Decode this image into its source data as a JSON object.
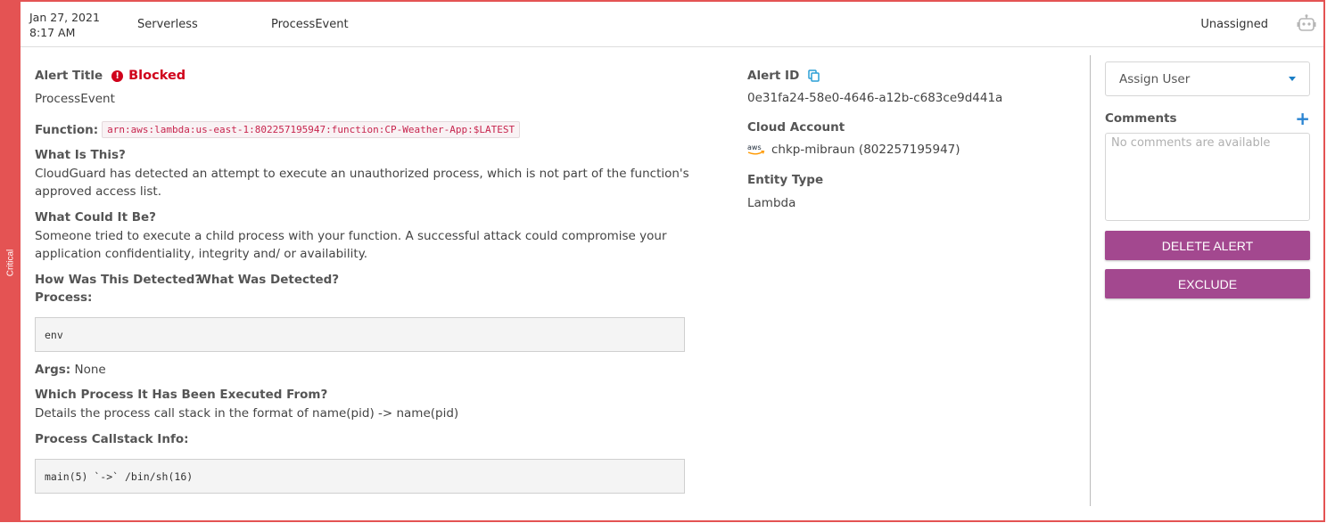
{
  "severity": {
    "label": "Critical",
    "color": "#e45353"
  },
  "header": {
    "date": "Jan 27, 2021",
    "time": "8:17 AM",
    "source": "Serverless",
    "rule": "ProcessEvent",
    "assignee": "Unassigned",
    "robot_icon": "robot-icon"
  },
  "details": {
    "alert_title_label": "Alert Title",
    "status": "Blocked",
    "status_icon": "!",
    "alert_title_value": "ProcessEvent",
    "function_label": "Function:",
    "function_value": "arn:aws:lambda:us-east-1:802257195947:function:CP-Weather-App:$LATEST",
    "what_is_label": "What Is This?",
    "what_is_text": "CloudGuard has detected an attempt to execute an unauthorized process, which is not part of the function's approved access list.",
    "could_be_label": "What Could It Be?",
    "could_be_text": "Someone tried to execute a child process with your function. A successful attack could compromise your application confidentiality, integrity and/ or availability.",
    "how_detected_label": "How Was This Detected?",
    "what_detected_label": "What Was Detected?",
    "process_label": "Process:",
    "process_value": "env",
    "args_label": "Args:",
    "args_value": "None",
    "executed_from_label": "Which Process It Has Been Executed From?",
    "executed_from_text": "Details the process call stack in the format of name(pid) -> name(pid)",
    "callstack_label": "Process Callstack Info:",
    "callstack_value": "main(5) `->` /bin/sh(16)"
  },
  "meta": {
    "alert_id_label": "Alert ID",
    "alert_id_value": "0e31fa24-58e0-4646-a12b-c683ce9d441a",
    "cloud_account_label": "Cloud Account",
    "cloud_account_value": "chkp-mibraun (802257195947)",
    "cloud_icon_text": "aws",
    "entity_type_label": "Entity Type",
    "entity_type_value": "Lambda"
  },
  "actions": {
    "assign_placeholder": "Assign User",
    "comments_label": "Comments",
    "add_comment": "+",
    "comments_empty": "No comments are available",
    "delete_label": "DELETE ALERT",
    "exclude_label": "EXCLUDE",
    "button_color": "#a3488f"
  }
}
